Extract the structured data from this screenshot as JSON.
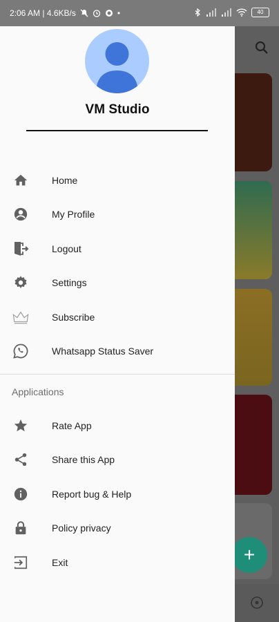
{
  "status_bar": {
    "time_speed": "2:06 AM | 4.6KB/s",
    "battery": "40"
  },
  "drawer": {
    "profile_name": "VM Studio",
    "main_items": [
      {
        "label": "Home",
        "icon": "home-icon"
      },
      {
        "label": "My Profile",
        "icon": "account-circle-icon"
      },
      {
        "label": "Logout",
        "icon": "logout-door-icon"
      },
      {
        "label": "Settings",
        "icon": "gear-icon"
      },
      {
        "label": "Subscribe",
        "icon": "crown-icon"
      },
      {
        "label": "Whatsapp Status Saver",
        "icon": "whatsapp-icon"
      }
    ],
    "section_title": "Applications",
    "app_items": [
      {
        "label": "Rate App",
        "icon": "star-icon"
      },
      {
        "label": "Share this App",
        "icon": "share-icon"
      },
      {
        "label": "Report bug & Help",
        "icon": "info-icon"
      },
      {
        "label": "Policy privacy",
        "icon": "lock-icon"
      },
      {
        "label": "Exit",
        "icon": "exit-icon"
      }
    ]
  },
  "background": {
    "fab_label": "+"
  },
  "colors": {
    "drawer_bg": "#fafafa",
    "avatar_bg": "#aaccff",
    "avatar_figure": "#3f74d8",
    "icon": "#616161",
    "fab": "#1e8e78"
  }
}
